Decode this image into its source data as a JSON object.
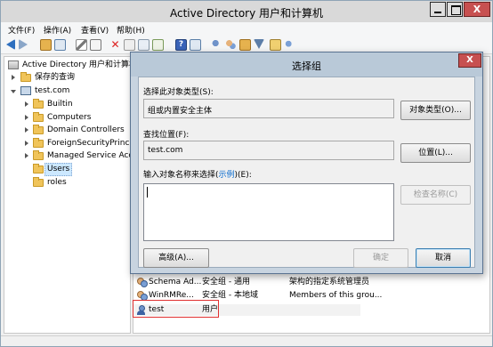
{
  "window": {
    "title": "Active Directory 用户和计算机",
    "close_glyph": "X"
  },
  "menu": [
    "文件(F)",
    "操作(A)",
    "查看(V)",
    "帮助(H)"
  ],
  "tree": {
    "root": "Active Directory 用户和计算机",
    "saved_queries": "保存的查询",
    "domain": "test.com",
    "children": [
      "Builtin",
      "Computers",
      "Domain Controllers",
      "ForeignSecurityPrincipals",
      "Managed Service Accounts",
      "Users",
      "roles"
    ]
  },
  "list": {
    "rows": [
      {
        "name": "Schema Ad...",
        "type": "安全组 - 通用",
        "desc": "架构的指定系统管理员"
      },
      {
        "name": "WinRMRe...",
        "type": "安全组 - 本地域",
        "desc": "Members of this grou..."
      },
      {
        "name": "test",
        "type": "用户",
        "desc": ""
      }
    ]
  },
  "dialog": {
    "title": "选择组",
    "close_glyph": "X",
    "object_type_label": "选择此对象类型(S):",
    "object_type_value": "组或内置安全主体",
    "object_type_button": "对象类型(O)...",
    "location_label": "查找位置(F):",
    "location_value": "test.com",
    "location_button": "位置(L)...",
    "names_label_prefix": "输入对象名称来选择(",
    "names_label_link": "示例",
    "names_label_suffix": ")(E):",
    "check_names_button": "检查名称(C)",
    "advanced_button": "高级(A)...",
    "ok_button": "确定",
    "cancel_button": "取消"
  }
}
